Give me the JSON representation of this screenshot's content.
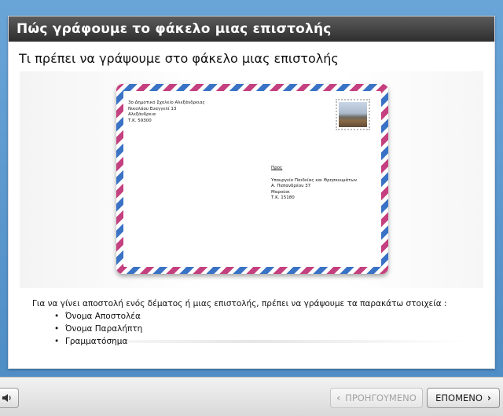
{
  "header": {
    "title": "Πώς γράφουμε το φάκελο μιας επιστολής"
  },
  "slide": {
    "subtitle": "Τι πρέπει να γράψουμε στο φάκελο μιας επιστολής",
    "envelope": {
      "sender_lines": [
        "3ο Δημοτικό Σχολείο Αλεξάνδρειας",
        "Νικολάου Ευαγγελί 13",
        "Αλεξάνδρεια",
        "Τ.Κ. 59300"
      ],
      "recipient_label": "Προς",
      "recipient_lines": [
        "Υπουργείο Παιδείας και Θρησκευμάτων",
        "Α. Παπανδρέου 37",
        "Μαρούσι",
        "Τ.Κ. 15180"
      ]
    },
    "body_intro": "Για να γίνει αποστολή ενός δέματος ή μιας επιστολής, πρέπει να γράψουμε τα παρακάτω στοιχεία :",
    "bullets": [
      "Όνομα Αποστολέα",
      "Όνομα Παραλήπτη",
      "Γραμματόσημα"
    ]
  },
  "footer": {
    "audio_icon": "speaker-icon",
    "prev_label": "ΠΡΟΗΓΟΥΜΕΝΟ",
    "next_label": "ΕΠΟΜΕΝΟ",
    "prev_icon": "‹",
    "next_icon": "›"
  },
  "colors": {
    "stripe_red": "#c4407e",
    "stripe_blue": "#3a73c5",
    "titlebar": "#3a3a3a",
    "background": "#5a97cf"
  }
}
